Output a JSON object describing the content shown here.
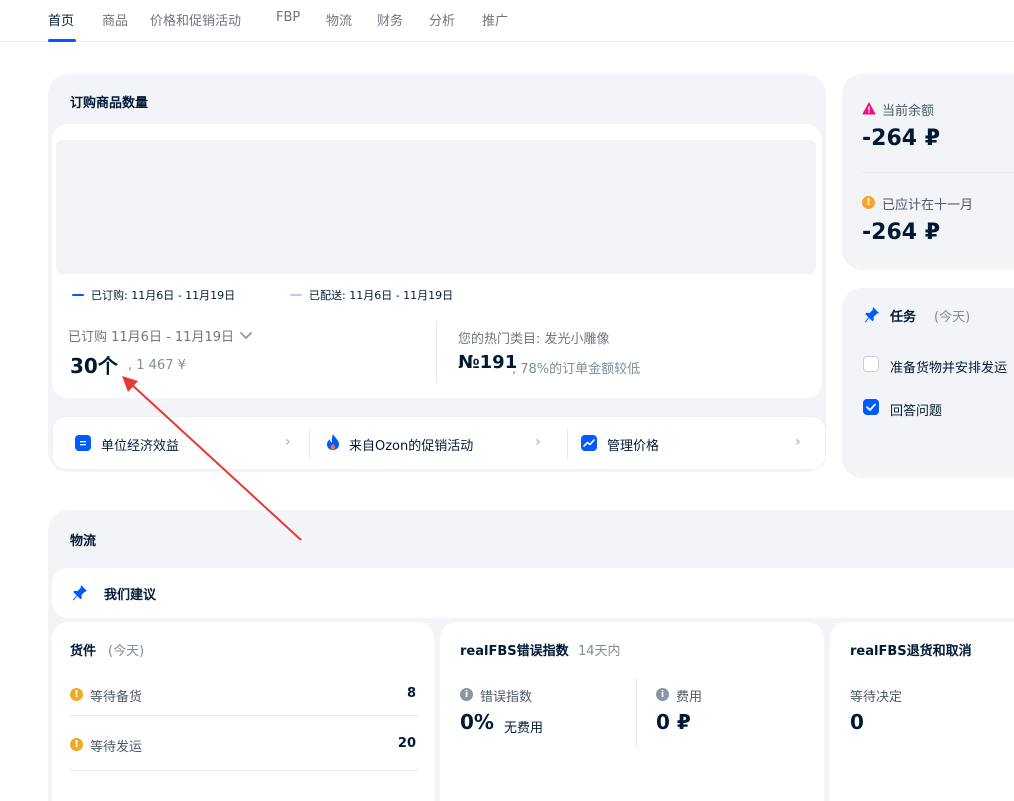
{
  "tabs": [
    "首页",
    "商品",
    "价格和促销活动",
    "FBP",
    "物流",
    "财务",
    "分析",
    "推广"
  ],
  "orders": {
    "panel_title": "订购商品数量",
    "legend_ordered": "已订购: 11月6日 - 11月19日",
    "legend_shipped": "已配送: 11月6日 - 11月19日",
    "period_label": "已订购 11月6日 - 11月19日",
    "count": "30个",
    "amount": ", 1 467 ¥",
    "top_category_label": "您的热门类目: 发光小雕像",
    "rank": "№191",
    "rank_note": ", 78%的订单金额较低",
    "colors": {
      "ordered": "#005bff",
      "shipped": "#b5cdfc"
    }
  },
  "quick_links": [
    {
      "label": "单位经济效益",
      "icon": "document-icon"
    },
    {
      "label": "来自Ozon的促销活动",
      "icon": "fire-icon"
    },
    {
      "label": "管理价格",
      "icon": "trend-icon"
    }
  ],
  "balance": {
    "current_label": "当前余额",
    "current_value": "-264 ₽",
    "accrued_label": "已应计在十一月",
    "accrued_value": "-264 ₽"
  },
  "tasks": {
    "title": "任务",
    "subtitle": "(今天)",
    "items": [
      {
        "label": "准备货物并安排发运",
        "checked": false
      },
      {
        "label": "回答问题",
        "checked": true
      }
    ]
  },
  "logistics": {
    "panel_title": "物流",
    "recommend_title": "我们建议",
    "shipments": {
      "title": "货件",
      "subtitle": "(今天)",
      "rows": [
        {
          "label": "等待备货",
          "value": "8"
        },
        {
          "label": "等待发运",
          "value": "20"
        }
      ]
    },
    "errors": {
      "title": "realFBS错误指数",
      "subtitle": "14天内",
      "index_label": "错误指数",
      "index_value": "0%",
      "index_note": "无费用",
      "cost_label": "费用",
      "cost_value": "0 ₽"
    },
    "returns": {
      "title": "realFBS退货和取消",
      "pending_label": "等待决定",
      "pending_value": "0"
    }
  }
}
